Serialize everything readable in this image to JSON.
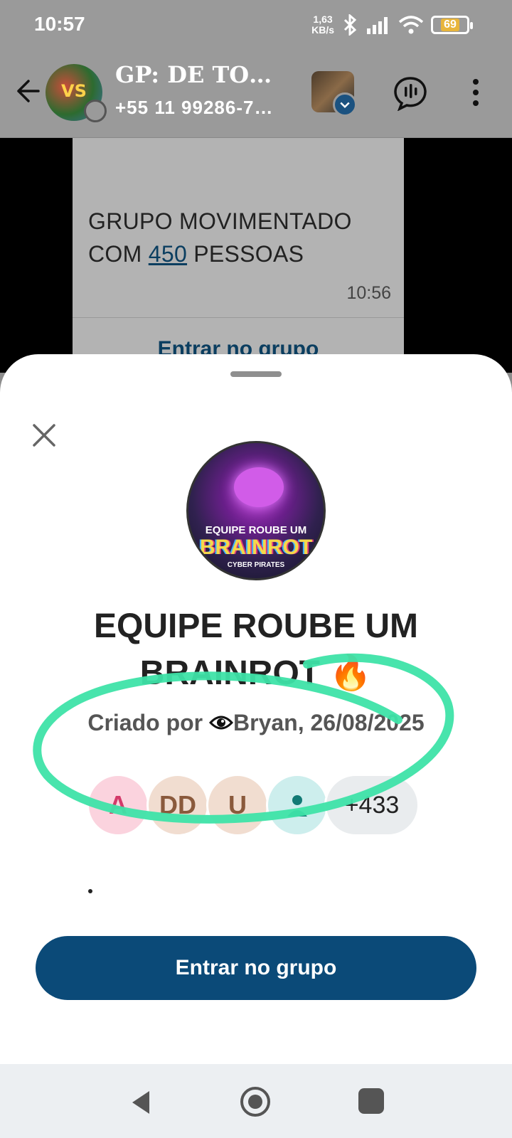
{
  "status_bar": {
    "time": "10:57",
    "net_speed_value": "1,63",
    "net_speed_unit": "KB/s",
    "battery": "69"
  },
  "header": {
    "title": "GP: DE TO…",
    "subtitle": "+55 11 99286-7…"
  },
  "message": {
    "text_before": "GRUPO MOVIMENTADO COM ",
    "link": "450",
    "text_after": " PESSOAS",
    "time": "10:56",
    "action_label": "Entrar no grupo"
  },
  "sheet": {
    "group_photo": {
      "line1": "EQUIPE ROUBE UM",
      "line2": "BRAINROT",
      "line3": "CYBER PIRATES"
    },
    "group_name": "EQUIPE ROUBE UM BRAINROT 🔥",
    "creator_prefix": "Criado por ",
    "creator_name": "Bryan, 26/08/2025",
    "members": [
      "A",
      "DD",
      "U"
    ],
    "more_count": "+433",
    "join_label": "Entrar no grupo"
  },
  "colors": {
    "accent": "#0b4a78",
    "highlighter": "#3ee3a8"
  }
}
